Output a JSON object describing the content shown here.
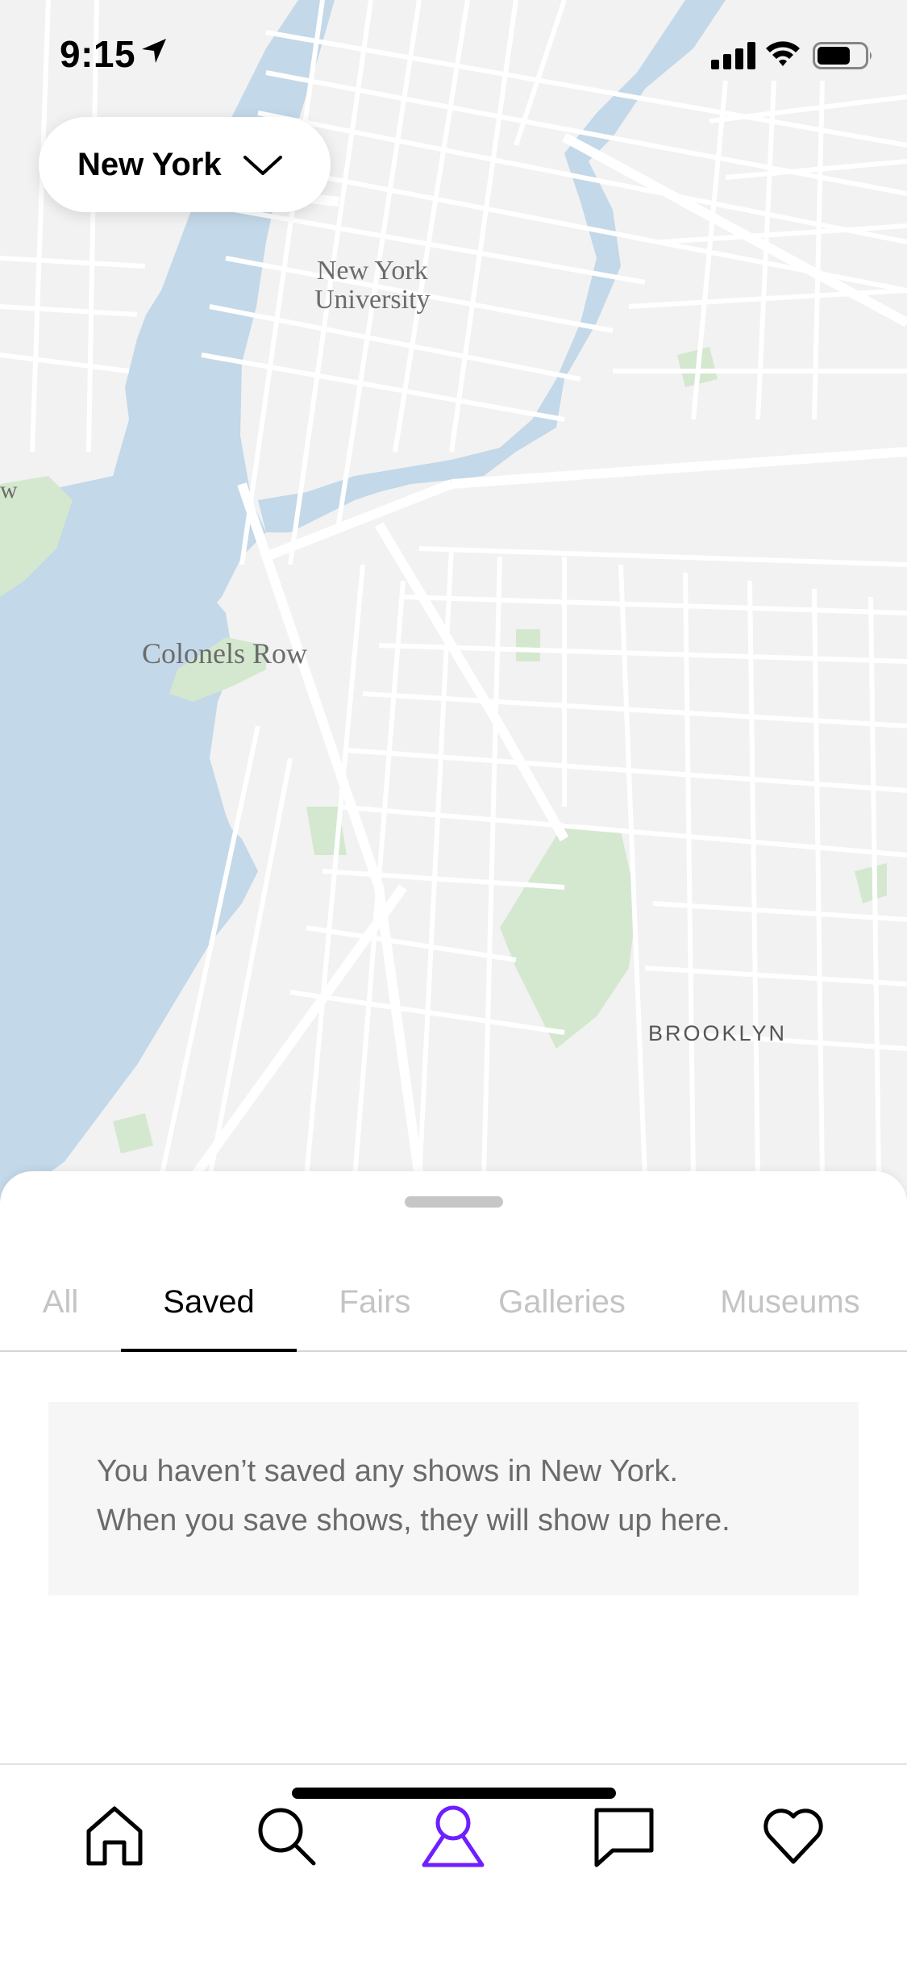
{
  "status_bar": {
    "time": "9:15"
  },
  "map": {
    "labels": {
      "nyu_line1": "New York",
      "nyu_line2": "University",
      "colonels_row": "Colonels Row",
      "brooklyn": "BROOKLYN",
      "edge_fragment": "w"
    },
    "colors": {
      "water": "#c3d8e8",
      "land": "#f2f2f2",
      "park": "#d4e8cf",
      "street": "#ffffff"
    }
  },
  "city_selector": {
    "label": "New York",
    "icon": "chevron-down-icon"
  },
  "tabs": [
    {
      "label": "All",
      "active": false
    },
    {
      "label": "Saved",
      "active": true
    },
    {
      "label": "Fairs",
      "active": false
    },
    {
      "label": "Galleries",
      "active": false
    },
    {
      "label": "Museums",
      "active": false
    }
  ],
  "empty_state": {
    "line1": "You haven’t saved any shows in New York.",
    "line2": "When you save shows, they will show up here."
  },
  "tabbar": {
    "items": [
      {
        "icon": "home-icon"
      },
      {
        "icon": "search-icon"
      },
      {
        "icon": "city-guide-icon",
        "active": true
      },
      {
        "icon": "inbox-icon"
      },
      {
        "icon": "heart-icon"
      }
    ],
    "active_color": "#6e1eff"
  }
}
